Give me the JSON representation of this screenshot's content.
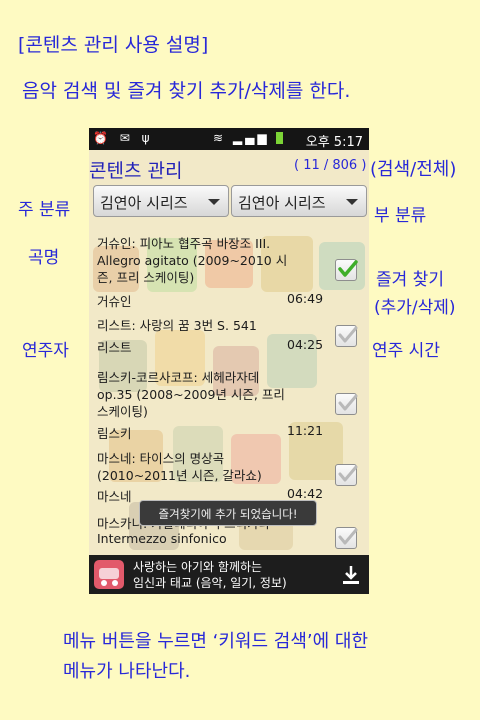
{
  "header": {
    "title": "[콘텐츠 관리 사용 설명]",
    "description": "음악 검색 및 즐겨 찾기 추가/삭제를 한다."
  },
  "statusbar": {
    "left_icons": "⏰ ✉ ψ",
    "right_icons": "📶 ⏰",
    "time": "오후 5:17"
  },
  "app": {
    "title": "콘텐츠 관리",
    "count": "( 11 / 806 )",
    "main_category": "김연아 시리즈",
    "sub_category": "김연아 시리즈",
    "songs": [
      {
        "title": "거슈인: 피아노 협주곡 바장조 III. Allegro agitato (2009~2010 시즌, 프리 스케이팅)",
        "artist": "거슈인",
        "duration": "06:49",
        "favorite": true
      },
      {
        "title": "리스트: 사랑의 꿈 3번 S. 541",
        "artist": "리스트",
        "duration": "04:25",
        "favorite": false
      },
      {
        "title": "림스키-코르사코프: 세헤라자데 op.35 (2008~2009년 시즌, 프리 스케이팅)",
        "artist": "림스키",
        "duration": "11:21",
        "favorite": false
      },
      {
        "title": "마스네: 타이스의 명상곡 (2010~2011년 시즌, 갈라쇼)",
        "artist": "마스네",
        "duration": "04:42",
        "favorite": false
      },
      {
        "title": "마스카니: 카발레리아 루스티카나",
        "artist": "Intermezzo sinfonico",
        "duration": "",
        "favorite": false
      }
    ],
    "toast": "즐겨찾기에 추가 되었습니다!",
    "ad": {
      "line1": "사랑하는 아기와 함께하는",
      "line2": "임신과 태교 (음악, 일기, 정보)"
    }
  },
  "annotations": {
    "search_all": "(검색/전체)",
    "main_category": "주 분류",
    "sub_category": "부 분류",
    "song_title": "곡명",
    "favorite_line1": "즐겨 찾기",
    "favorite_line2": "(추가/삭제)",
    "artist": "연주자",
    "duration": "연주 시간"
  },
  "footer": {
    "line1": "메뉴 버튼을 누르면 ‘키워드 검색’에 대한",
    "line2": "메뉴가 나타난다."
  },
  "colors": {
    "background": "#fefac2",
    "annotation_text": "#2828d8",
    "check_green": "#3fae2a"
  }
}
